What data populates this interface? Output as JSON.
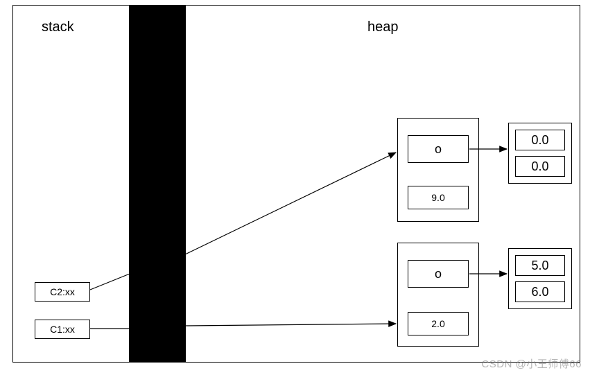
{
  "stack": {
    "title": "stack",
    "items": [
      {
        "label": "C2:xx"
      },
      {
        "label": "C1:xx"
      }
    ]
  },
  "heap": {
    "title": "heap",
    "objects": [
      {
        "ref_label": "o",
        "field_value": "9.0",
        "target": {
          "values": [
            "0.0",
            "0.0"
          ]
        }
      },
      {
        "ref_label": "o",
        "field_value": "2.0",
        "target": {
          "values": [
            "5.0",
            "6.0"
          ]
        }
      }
    ]
  },
  "watermark": "CSDN @小王师傅66"
}
